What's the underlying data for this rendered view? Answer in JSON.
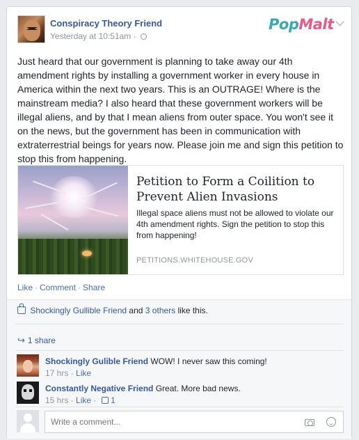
{
  "post": {
    "author": "Conspiracy Theory Friend",
    "timestamp": "Yesterday at 10:51am",
    "privacy_icon": "globe-icon",
    "brand_logo_part1": "Pop",
    "brand_logo_part2": "Malt",
    "text": "Just heard that our government is planning to take away our 4th amendment rights by installing a government worker in every house in America within the next two years. This is an OUTRAGE! Where is the mainstream media? I also heard that these government workers will be illegal aliens, and by that I mean aliens from outer space. You won't see it on the news, but the government has been in communication with extraterrestrial beings for years now. Please join me and sign this petition to stop this from happening."
  },
  "link_preview": {
    "title": "Petition to Form a Coilition to Prevent Alien Invasions",
    "description": "Illegal space aliens must not be allowed to violate our 4th amendment rights. Sign the petition to stop this from happening!",
    "domain": "PETITIONS.WHITEHOUSE.GOV"
  },
  "actions": {
    "like": "Like",
    "comment": "Comment",
    "share": "Share",
    "separator": "·"
  },
  "likes": {
    "liker": "Shockingly Gullible Friend",
    "connector": "and",
    "others": "3 others",
    "suffix": "like this."
  },
  "shares": {
    "label": "1 share"
  },
  "comments": [
    {
      "name": "Shockingly Gulible Friend",
      "text": "WOW! I never saw this coming!",
      "time": "17 hrs",
      "like": "Like",
      "like_count": ""
    },
    {
      "name": "Constantly Negative Friend",
      "text": "Great. More bad news.",
      "time": "15 hrs",
      "like": "Like",
      "like_count": "1"
    }
  ],
  "write_comment": {
    "placeholder": "Write a comment..."
  },
  "colors": {
    "link_blue": "#365899",
    "brand_teal": "#3aa8b0",
    "brand_pink": "#e85a86"
  }
}
